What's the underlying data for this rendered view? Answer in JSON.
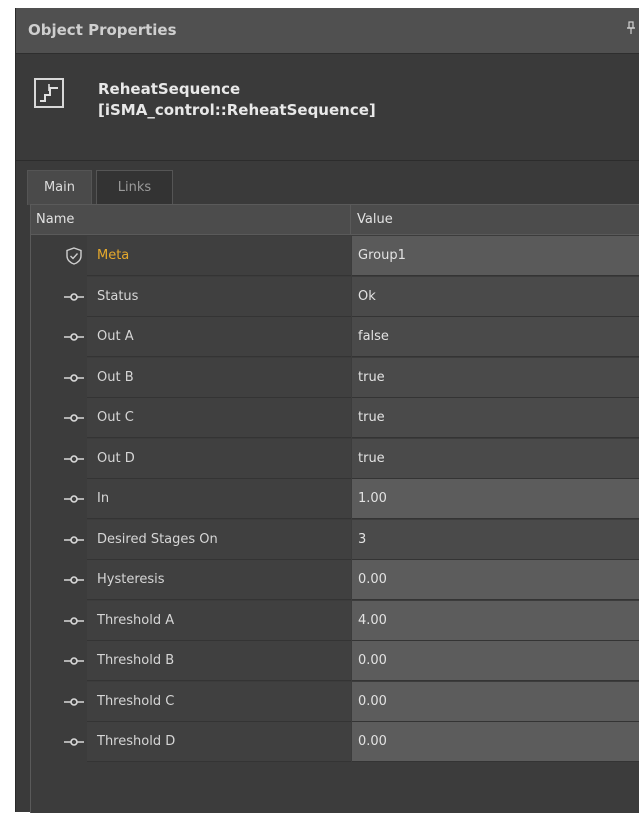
{
  "panel": {
    "title": "Object Properties",
    "pin_glyph": "Ͱ"
  },
  "object": {
    "name": "ReheatSequence",
    "type": "[iSMA_control::ReheatSequence]",
    "icon": "step-sequence-icon"
  },
  "tabs": [
    {
      "label": "Main",
      "active": true
    },
    {
      "label": "Links",
      "active": false
    }
  ],
  "columns": {
    "name": "Name",
    "value": "Value"
  },
  "rows": [
    {
      "name": "Meta",
      "value": "Group1",
      "icon": "shield-check-icon"
    },
    {
      "name": "Status",
      "value": "Ok",
      "icon": "link-pin-icon"
    },
    {
      "name": "Out A",
      "value": "false",
      "icon": "link-pin-icon"
    },
    {
      "name": "Out B",
      "value": "true",
      "icon": "link-pin-icon"
    },
    {
      "name": "Out C",
      "value": "true",
      "icon": "link-pin-icon"
    },
    {
      "name": "Out D",
      "value": "true",
      "icon": "link-pin-icon"
    },
    {
      "name": "In",
      "value": "1.00",
      "icon": "link-pin-icon"
    },
    {
      "name": "Desired Stages On",
      "value": "3",
      "icon": "link-pin-icon"
    },
    {
      "name": "Hysteresis",
      "value": "0.00",
      "icon": "link-pin-icon"
    },
    {
      "name": "Threshold A",
      "value": "4.00",
      "icon": "link-pin-icon"
    },
    {
      "name": "Threshold B",
      "value": "0.00",
      "icon": "link-pin-icon"
    },
    {
      "name": "Threshold C",
      "value": "0.00",
      "icon": "link-pin-icon"
    },
    {
      "name": "Threshold D",
      "value": "0.00",
      "icon": "link-pin-icon"
    }
  ],
  "colors": {
    "meta_accent": "#e6a92c",
    "panel_bg": "#3a3a3a"
  }
}
